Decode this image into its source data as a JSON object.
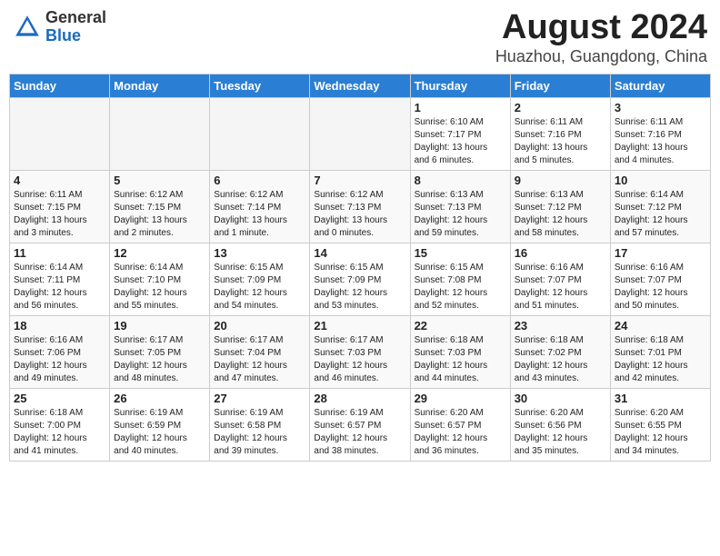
{
  "header": {
    "logo_line1": "General",
    "logo_line2": "Blue",
    "title": "August 2024",
    "subtitle": "Huazhou, Guangdong, China"
  },
  "weekdays": [
    "Sunday",
    "Monday",
    "Tuesday",
    "Wednesday",
    "Thursday",
    "Friday",
    "Saturday"
  ],
  "weeks": [
    [
      {
        "day": "",
        "info": ""
      },
      {
        "day": "",
        "info": ""
      },
      {
        "day": "",
        "info": ""
      },
      {
        "day": "",
        "info": ""
      },
      {
        "day": "1",
        "info": "Sunrise: 6:10 AM\nSunset: 7:17 PM\nDaylight: 13 hours\nand 6 minutes."
      },
      {
        "day": "2",
        "info": "Sunrise: 6:11 AM\nSunset: 7:16 PM\nDaylight: 13 hours\nand 5 minutes."
      },
      {
        "day": "3",
        "info": "Sunrise: 6:11 AM\nSunset: 7:16 PM\nDaylight: 13 hours\nand 4 minutes."
      }
    ],
    [
      {
        "day": "4",
        "info": "Sunrise: 6:11 AM\nSunset: 7:15 PM\nDaylight: 13 hours\nand 3 minutes."
      },
      {
        "day": "5",
        "info": "Sunrise: 6:12 AM\nSunset: 7:15 PM\nDaylight: 13 hours\nand 2 minutes."
      },
      {
        "day": "6",
        "info": "Sunrise: 6:12 AM\nSunset: 7:14 PM\nDaylight: 13 hours\nand 1 minute."
      },
      {
        "day": "7",
        "info": "Sunrise: 6:12 AM\nSunset: 7:13 PM\nDaylight: 13 hours\nand 0 minutes."
      },
      {
        "day": "8",
        "info": "Sunrise: 6:13 AM\nSunset: 7:13 PM\nDaylight: 12 hours\nand 59 minutes."
      },
      {
        "day": "9",
        "info": "Sunrise: 6:13 AM\nSunset: 7:12 PM\nDaylight: 12 hours\nand 58 minutes."
      },
      {
        "day": "10",
        "info": "Sunrise: 6:14 AM\nSunset: 7:12 PM\nDaylight: 12 hours\nand 57 minutes."
      }
    ],
    [
      {
        "day": "11",
        "info": "Sunrise: 6:14 AM\nSunset: 7:11 PM\nDaylight: 12 hours\nand 56 minutes."
      },
      {
        "day": "12",
        "info": "Sunrise: 6:14 AM\nSunset: 7:10 PM\nDaylight: 12 hours\nand 55 minutes."
      },
      {
        "day": "13",
        "info": "Sunrise: 6:15 AM\nSunset: 7:09 PM\nDaylight: 12 hours\nand 54 minutes."
      },
      {
        "day": "14",
        "info": "Sunrise: 6:15 AM\nSunset: 7:09 PM\nDaylight: 12 hours\nand 53 minutes."
      },
      {
        "day": "15",
        "info": "Sunrise: 6:15 AM\nSunset: 7:08 PM\nDaylight: 12 hours\nand 52 minutes."
      },
      {
        "day": "16",
        "info": "Sunrise: 6:16 AM\nSunset: 7:07 PM\nDaylight: 12 hours\nand 51 minutes."
      },
      {
        "day": "17",
        "info": "Sunrise: 6:16 AM\nSunset: 7:07 PM\nDaylight: 12 hours\nand 50 minutes."
      }
    ],
    [
      {
        "day": "18",
        "info": "Sunrise: 6:16 AM\nSunset: 7:06 PM\nDaylight: 12 hours\nand 49 minutes."
      },
      {
        "day": "19",
        "info": "Sunrise: 6:17 AM\nSunset: 7:05 PM\nDaylight: 12 hours\nand 48 minutes."
      },
      {
        "day": "20",
        "info": "Sunrise: 6:17 AM\nSunset: 7:04 PM\nDaylight: 12 hours\nand 47 minutes."
      },
      {
        "day": "21",
        "info": "Sunrise: 6:17 AM\nSunset: 7:03 PM\nDaylight: 12 hours\nand 46 minutes."
      },
      {
        "day": "22",
        "info": "Sunrise: 6:18 AM\nSunset: 7:03 PM\nDaylight: 12 hours\nand 44 minutes."
      },
      {
        "day": "23",
        "info": "Sunrise: 6:18 AM\nSunset: 7:02 PM\nDaylight: 12 hours\nand 43 minutes."
      },
      {
        "day": "24",
        "info": "Sunrise: 6:18 AM\nSunset: 7:01 PM\nDaylight: 12 hours\nand 42 minutes."
      }
    ],
    [
      {
        "day": "25",
        "info": "Sunrise: 6:18 AM\nSunset: 7:00 PM\nDaylight: 12 hours\nand 41 minutes."
      },
      {
        "day": "26",
        "info": "Sunrise: 6:19 AM\nSunset: 6:59 PM\nDaylight: 12 hours\nand 40 minutes."
      },
      {
        "day": "27",
        "info": "Sunrise: 6:19 AM\nSunset: 6:58 PM\nDaylight: 12 hours\nand 39 minutes."
      },
      {
        "day": "28",
        "info": "Sunrise: 6:19 AM\nSunset: 6:57 PM\nDaylight: 12 hours\nand 38 minutes."
      },
      {
        "day": "29",
        "info": "Sunrise: 6:20 AM\nSunset: 6:57 PM\nDaylight: 12 hours\nand 36 minutes."
      },
      {
        "day": "30",
        "info": "Sunrise: 6:20 AM\nSunset: 6:56 PM\nDaylight: 12 hours\nand 35 minutes."
      },
      {
        "day": "31",
        "info": "Sunrise: 6:20 AM\nSunset: 6:55 PM\nDaylight: 12 hours\nand 34 minutes."
      }
    ]
  ]
}
